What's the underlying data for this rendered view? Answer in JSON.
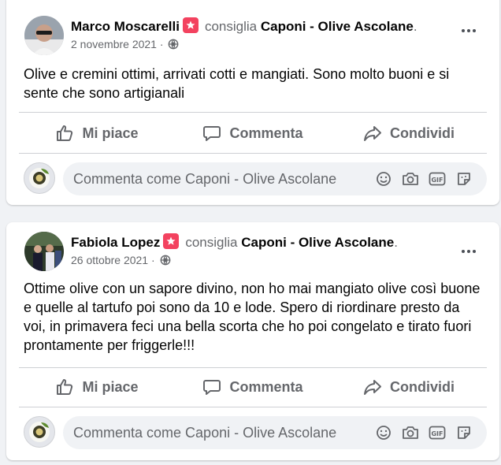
{
  "posts": [
    {
      "author": "Marco Moscarelli",
      "verb": "consiglia",
      "page": "Caponi - Olive Ascolane",
      "date": "2 novembre 2021",
      "date_sep": "·",
      "text": "Olive e cremini ottimi, arrivati cotti e mangiati. Sono molto buoni e si sente che sono artigianali"
    },
    {
      "author": "Fabiola Lopez",
      "verb": "consiglia",
      "page": "Caponi - Olive Ascolane",
      "date": "26 ottobre 2021",
      "date_sep": "·",
      "text": "Ottime olive con un sapore divino, non ho mai mangiato olive così buone e quelle al tartufo poi sono da 10 e lode. Spero di riordinare presto da voi, in primavera feci una bella scorta che ho poi congelato e tirato fuori prontamente per friggerle!!!"
    }
  ],
  "actions": {
    "like": "Mi piace",
    "comment": "Commenta",
    "share": "Condividi"
  },
  "comment_placeholder": "Commenta come Caponi - Olive Ascolane",
  "icons": {
    "recommend": "recommend-badge-icon",
    "audience": "globe-icon",
    "more": "more-options-icon",
    "like": "thumbs-up-icon",
    "comment": "speech-bubble-icon",
    "share": "share-arrow-icon",
    "emoji": "smiley-icon",
    "camera": "camera-icon",
    "gif": "gif-icon",
    "sticker": "sticker-icon"
  },
  "colors": {
    "background": "#f0f2f5",
    "card": "#ffffff",
    "recommend_badge": "#f3425f",
    "secondary_text": "#65676b"
  }
}
